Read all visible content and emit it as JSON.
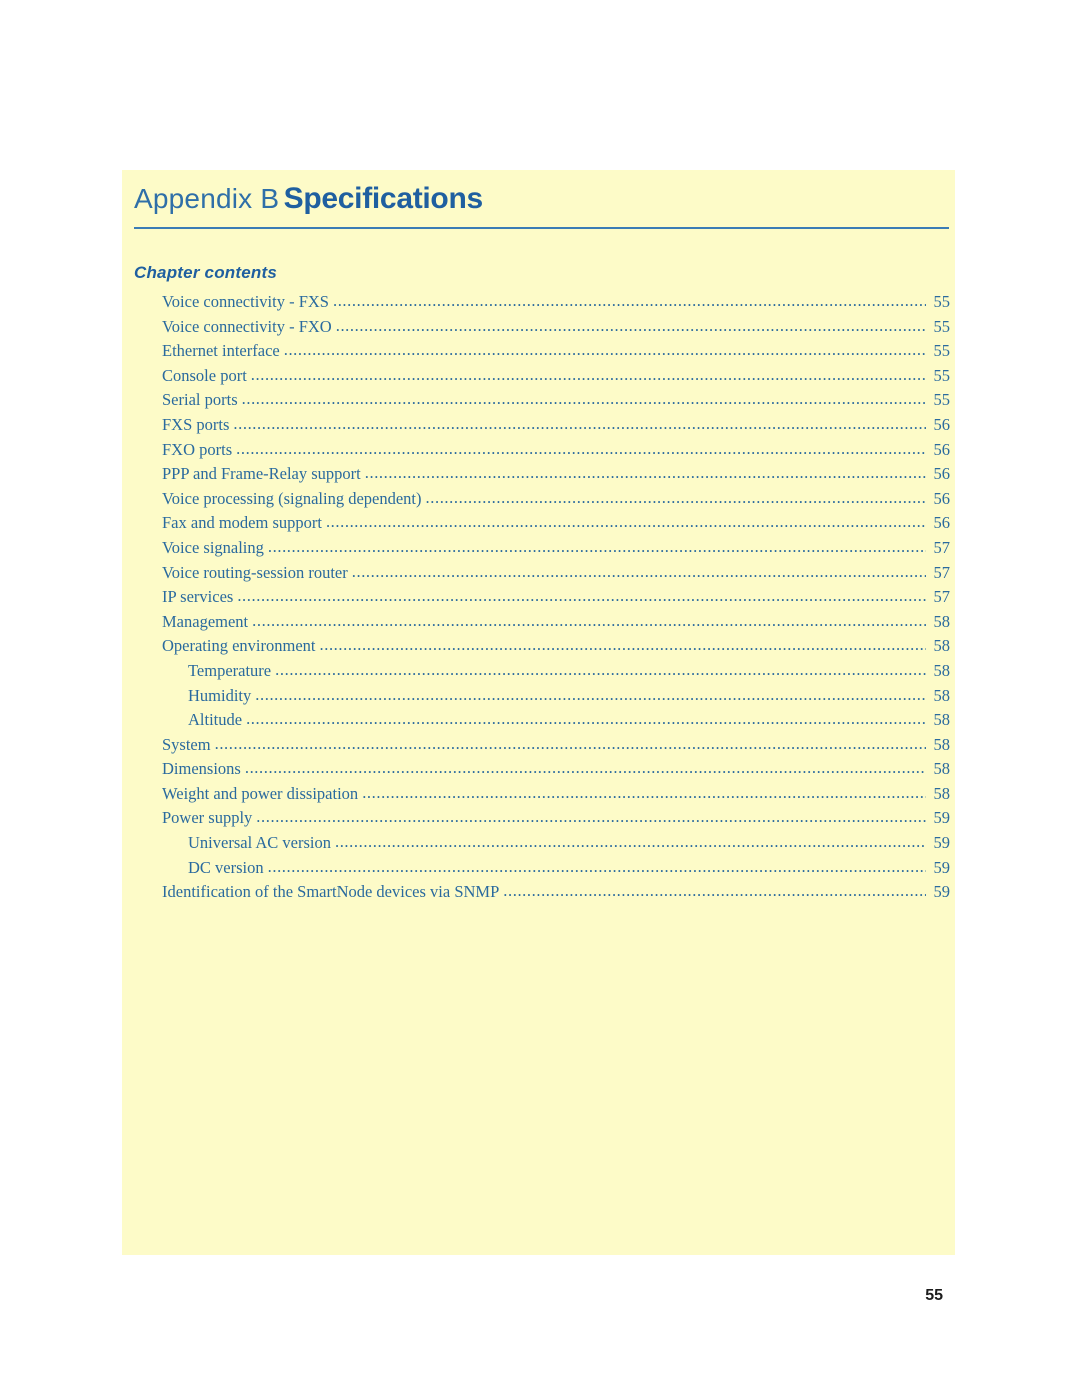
{
  "header": {
    "appendix_label": "Appendix B",
    "title": "Specifications"
  },
  "chapter_contents_heading": "Chapter contents",
  "toc": [
    {
      "label": "Voice connectivity - FXS",
      "page": "55",
      "indent": false
    },
    {
      "label": "Voice connectivity - FXO",
      "page": "55",
      "indent": false
    },
    {
      "label": "Ethernet interface",
      "page": "55",
      "indent": false
    },
    {
      "label": "Console port",
      "page": "55",
      "indent": false
    },
    {
      "label": "Serial ports",
      "page": "55",
      "indent": false
    },
    {
      "label": "FXS ports",
      "page": "56",
      "indent": false
    },
    {
      "label": "FXO ports",
      "page": "56",
      "indent": false
    },
    {
      "label": "PPP and Frame-Relay support",
      "page": "56",
      "indent": false
    },
    {
      "label": "Voice processing (signaling dependent)",
      "page": "56",
      "indent": false
    },
    {
      "label": "Fax and modem support",
      "page": "56",
      "indent": false
    },
    {
      "label": "Voice signaling",
      "page": "57",
      "indent": false
    },
    {
      "label": "Voice routing-session router",
      "page": "57",
      "indent": false
    },
    {
      "label": "IP services",
      "page": "57",
      "indent": false
    },
    {
      "label": "Management",
      "page": "58",
      "indent": false
    },
    {
      "label": "Operating environment",
      "page": "58",
      "indent": false
    },
    {
      "label": "Temperature",
      "page": "58",
      "indent": true
    },
    {
      "label": "Humidity",
      "page": "58",
      "indent": true
    },
    {
      "label": "Altitude",
      "page": "58",
      "indent": true
    },
    {
      "label": "System",
      "page": "58",
      "indent": false
    },
    {
      "label": "Dimensions",
      "page": "58",
      "indent": false
    },
    {
      "label": "Weight and power dissipation",
      "page": "58",
      "indent": false
    },
    {
      "label": "Power supply",
      "page": "59",
      "indent": false
    },
    {
      "label": "Universal AC version",
      "page": "59",
      "indent": true
    },
    {
      "label": "DC version",
      "page": "59",
      "indent": true
    },
    {
      "label": "Identification of the SmartNode devices via SNMP",
      "page": "59",
      "indent": false
    }
  ],
  "footer": {
    "page_number": "55"
  },
  "colors": {
    "panel_background": "#fdfbc8",
    "accent_blue": "#1f5fa0",
    "text_blue": "#2a6a9e",
    "rule": "#3b7cb5"
  }
}
